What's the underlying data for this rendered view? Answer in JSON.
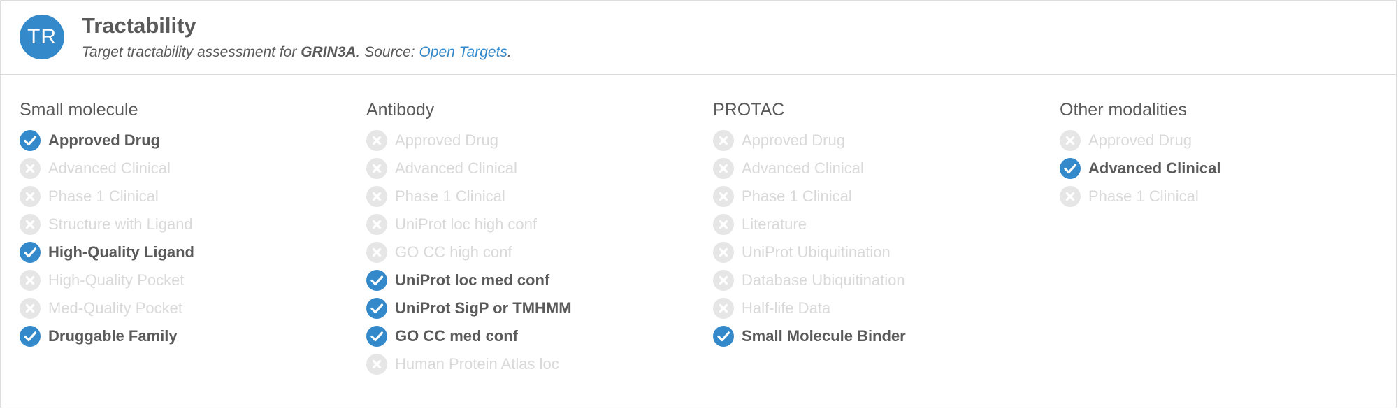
{
  "header": {
    "avatar_text": "TR",
    "title": "Tractability",
    "subtitle_prefix": "Target tractability assessment for ",
    "target": "GRIN3A",
    "subtitle_mid": ". Source: ",
    "source_link": "Open Targets",
    "subtitle_suffix": "."
  },
  "colors": {
    "accent": "#3489ca",
    "inactive_text": "#d9d9d9",
    "inactive_icon": "#e6e6e6",
    "text": "#5a5a5a"
  },
  "columns": [
    {
      "title": "Small molecule",
      "items": [
        {
          "label": "Approved Drug",
          "met": true
        },
        {
          "label": "Advanced Clinical",
          "met": false
        },
        {
          "label": "Phase 1 Clinical",
          "met": false
        },
        {
          "label": "Structure with Ligand",
          "met": false
        },
        {
          "label": "High-Quality Ligand",
          "met": true
        },
        {
          "label": "High-Quality Pocket",
          "met": false
        },
        {
          "label": "Med-Quality Pocket",
          "met": false
        },
        {
          "label": "Druggable Family",
          "met": true
        }
      ]
    },
    {
      "title": "Antibody",
      "items": [
        {
          "label": "Approved Drug",
          "met": false
        },
        {
          "label": "Advanced Clinical",
          "met": false
        },
        {
          "label": "Phase 1 Clinical",
          "met": false
        },
        {
          "label": "UniProt loc high conf",
          "met": false
        },
        {
          "label": "GO CC high conf",
          "met": false
        },
        {
          "label": "UniProt loc med conf",
          "met": true
        },
        {
          "label": "UniProt SigP or TMHMM",
          "met": true
        },
        {
          "label": "GO CC med conf",
          "met": true
        },
        {
          "label": "Human Protein Atlas loc",
          "met": false
        }
      ]
    },
    {
      "title": "PROTAC",
      "items": [
        {
          "label": "Approved Drug",
          "met": false
        },
        {
          "label": "Advanced Clinical",
          "met": false
        },
        {
          "label": "Phase 1 Clinical",
          "met": false
        },
        {
          "label": "Literature",
          "met": false
        },
        {
          "label": "UniProt Ubiquitination",
          "met": false
        },
        {
          "label": "Database Ubiquitination",
          "met": false
        },
        {
          "label": "Half-life Data",
          "met": false
        },
        {
          "label": "Small Molecule Binder",
          "met": true
        }
      ]
    },
    {
      "title": "Other modalities",
      "items": [
        {
          "label": "Approved Drug",
          "met": false
        },
        {
          "label": "Advanced Clinical",
          "met": true
        },
        {
          "label": "Phase 1 Clinical",
          "met": false
        }
      ]
    }
  ]
}
